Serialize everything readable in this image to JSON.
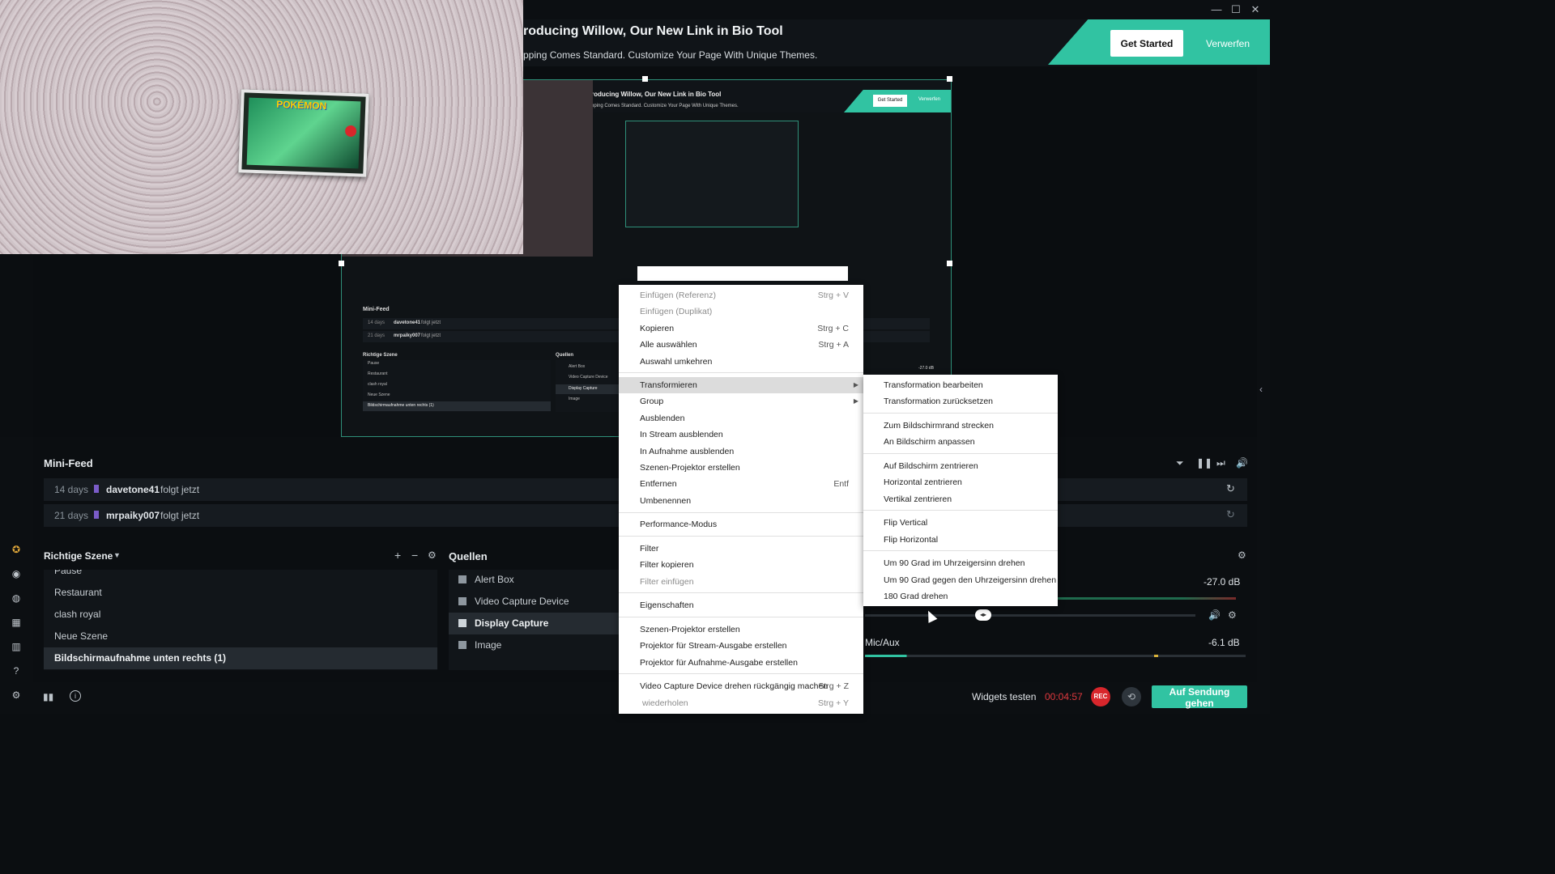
{
  "window": {
    "min_glyph": "—",
    "max_glyph": "☐",
    "close_glyph": "✕"
  },
  "banner": {
    "title": "roducing Willow, Our New Link in Bio Tool",
    "subtitle": "pping Comes Standard. Customize Your Page With Unique Themes.",
    "get_started": "Get Started",
    "discard": "Verwerfen",
    "accent": "#31c3a2"
  },
  "webcam": {
    "card_text": "POKÉMON"
  },
  "nested": {
    "banner_title": "roducing Willow, Our New Link in Bio Tool",
    "banner_sub": "pping Comes Standard. Customize Your Page With Unique Themes.",
    "get_started": "Get Started",
    "discard": "Verwerfen",
    "minifeed": "Mini-Feed",
    "feed1_days": "14 days",
    "feed1_user": "davetone41",
    "feed1_action": "folgt jetzt",
    "feed2_days": "21 days",
    "feed2_user": "mrpaiky007",
    "feed2_action": "folgt jetzt",
    "scene_head": "Richtige Szene",
    "sources_head": "Quellen",
    "scenes": [
      "Pause",
      "Restaurant",
      "clash royal",
      "Neue Szene",
      "Bildschirmaufnahme unten rechts (1)"
    ],
    "sources": [
      "Alert Box",
      "Video Capture Device",
      "Display Capture",
      "Image"
    ],
    "db": "-27.0 dB"
  },
  "minifeed": {
    "title": "Mini-Feed",
    "rows": [
      {
        "days": "14 days",
        "user": "davetone41",
        "action": "folgt jetzt"
      },
      {
        "days": "21 days",
        "user": "mrpaiky007",
        "action": "folgt jetzt"
      }
    ]
  },
  "scenes": {
    "title": "Richtige Szene",
    "items": [
      "Pause",
      "Restaurant",
      "clash royal",
      "Neue Szene",
      "Bildschirmaufnahme unten rechts (1)"
    ]
  },
  "sources": {
    "title": "Quellen",
    "items": [
      "Alert Box",
      "Video Capture Device",
      "Display Capture",
      "Image"
    ]
  },
  "mixer": {
    "db1": "-27.0 dB",
    "channel2": "Mic/Aux",
    "db2": "-6.1 dB"
  },
  "bottom": {
    "widgets_test": "Widgets testen",
    "timer": "00:04:57",
    "rec": "REC",
    "go_live": "Auf Sendung gehen"
  },
  "context_menu": {
    "items": [
      {
        "label": "Einfügen (Referenz)",
        "shortcut": "Strg + V",
        "disabled": true
      },
      {
        "label": "Einfügen (Duplikat)",
        "shortcut": "",
        "disabled": true
      },
      {
        "label": "Kopieren",
        "shortcut": "Strg + C"
      },
      {
        "label": "Alle auswählen",
        "shortcut": "Strg + A"
      },
      {
        "label": "Auswahl umkehren",
        "shortcut": ""
      },
      {
        "label": "Transformieren",
        "shortcut": "",
        "submenu": true,
        "highlighted": true
      },
      {
        "label": "Group",
        "shortcut": "",
        "submenu": true
      },
      {
        "label": "Ausblenden",
        "shortcut": ""
      },
      {
        "label": "In Stream ausblenden",
        "shortcut": ""
      },
      {
        "label": "In Aufnahme ausblenden",
        "shortcut": ""
      },
      {
        "label": "Szenen-Projektor erstellen",
        "shortcut": ""
      },
      {
        "label": "Entfernen",
        "shortcut": "Entf"
      },
      {
        "label": "Umbenennen",
        "shortcut": ""
      },
      {
        "label": "Performance-Modus",
        "shortcut": ""
      },
      {
        "label": "Filter",
        "shortcut": ""
      },
      {
        "label": "Filter kopieren",
        "shortcut": ""
      },
      {
        "label": "Filter einfügen",
        "shortcut": "",
        "disabled": true
      },
      {
        "label": "Eigenschaften",
        "shortcut": ""
      },
      {
        "label": "Szenen-Projektor erstellen",
        "shortcut": ""
      },
      {
        "label": "Projektor für Stream-Ausgabe erstellen",
        "shortcut": ""
      },
      {
        "label": "Projektor für Aufnahme-Ausgabe erstellen",
        "shortcut": ""
      },
      {
        "label": "Video Capture Device drehen rückgängig machen",
        "shortcut": "Strg + Z"
      },
      {
        "label": "wiederholen",
        "shortcut": "Strg + Y",
        "disabled": true
      }
    ]
  },
  "submenu": {
    "items": [
      "Transformation bearbeiten",
      "Transformation zurücksetzen",
      "Zum Bildschirmrand strecken",
      "An Bildschirm anpassen",
      "Auf Bildschirm zentrieren",
      "Horizontal zentrieren",
      "Vertikal zentrieren",
      "Flip Vertical",
      "Flip Horizontal",
      "Um 90 Grad im Uhrzeigersinn drehen",
      "Um 90 Grad gegen den Uhrzeigersinn drehen",
      "180 Grad drehen"
    ]
  }
}
